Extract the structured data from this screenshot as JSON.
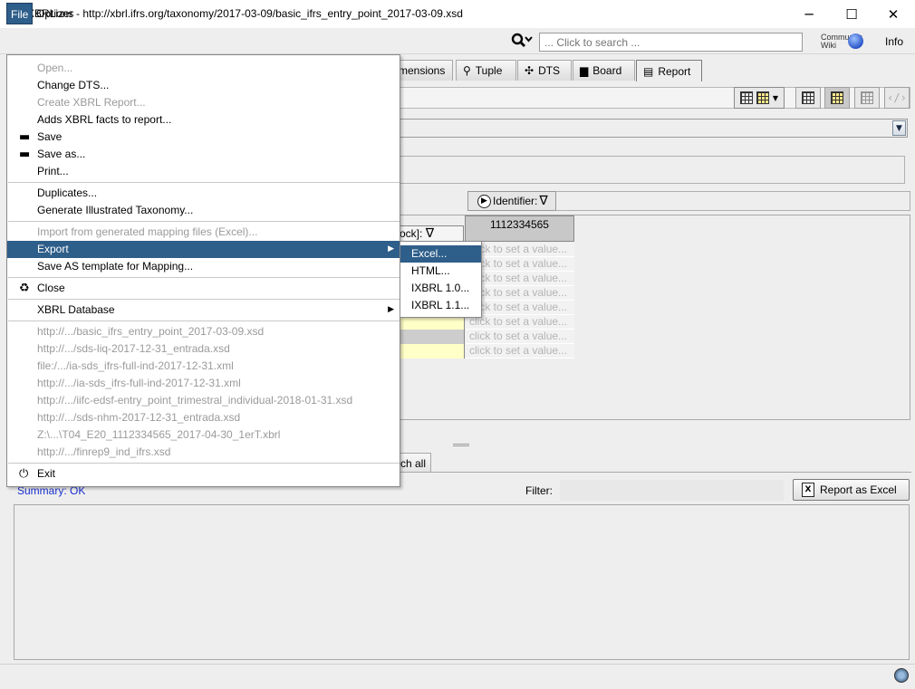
{
  "window": {
    "title": "XBRLizer - http://xbrl.ifrs.org/taxonomy/2017-03-09/basic_ifrs_entry_point_2017-03-09.xsd",
    "minimize": "─",
    "maximize": "☐",
    "close": "✕"
  },
  "menubar": {
    "file": "File",
    "options": "Options",
    "search_placeholder": "... Click to search ...",
    "community_wiki_line1": "Community",
    "community_wiki_line2": "Wiki",
    "info": "Info"
  },
  "tabs": [
    {
      "label": "mensions",
      "icon": ""
    },
    {
      "label": "Tuple",
      "icon": "paperclip-icon"
    },
    {
      "label": "DTS",
      "icon": "network-icon"
    },
    {
      "label": "Board",
      "icon": "board-icon"
    },
    {
      "label": "Report",
      "icon": "xbrl-report-icon",
      "active": true
    }
  ],
  "grid": {
    "block_header": "ock]:",
    "identifier_header": "Identifier:",
    "column_value": "1112334565",
    "placeholder": "click to set a value...",
    "row_colors": [
      "#eeeeee",
      "#eeeeee",
      "#eeeeee",
      "#eeeeee",
      "#eeeeee",
      "#ffffc8",
      "#cdcdcd",
      "#ffffc8"
    ]
  },
  "bottom": {
    "tab_label": "ch all",
    "summary": "Summary: OK",
    "filter_label": "Filter:",
    "filter_value": "",
    "report_button": "Report as Excel"
  },
  "file_menu": {
    "groups": [
      [
        {
          "label": "Open...",
          "disabled": true,
          "icon": ""
        },
        {
          "label": "Change DTS...",
          "disabled": false,
          "icon": ""
        },
        {
          "label": "Create XBRL Report...",
          "disabled": true,
          "icon": ""
        },
        {
          "label": "Adds XBRL facts to report...",
          "disabled": false,
          "icon": ""
        },
        {
          "label": "Save",
          "disabled": false,
          "icon": "save-icon"
        },
        {
          "label": "Save as...",
          "disabled": false,
          "icon": "save-as-icon"
        },
        {
          "label": "Print...",
          "disabled": false,
          "icon": ""
        }
      ],
      [
        {
          "label": "Duplicates...",
          "disabled": false,
          "icon": ""
        },
        {
          "label": "Generate Illustrated Taxonomy...",
          "disabled": false,
          "icon": ""
        }
      ],
      [
        {
          "label": "Import from generated mapping files (Excel)...",
          "disabled": true,
          "icon": ""
        },
        {
          "label": "Export",
          "disabled": false,
          "icon": "",
          "submenu": true,
          "selected": true
        },
        {
          "label": "Save AS template for Mapping...",
          "disabled": false,
          "icon": ""
        }
      ],
      [
        {
          "label": "Close",
          "disabled": false,
          "icon": "recycle-icon"
        }
      ],
      [
        {
          "label": "XBRL Database",
          "disabled": false,
          "icon": "",
          "submenu": true
        }
      ],
      [
        {
          "label": "http://.../basic_ifrs_entry_point_2017-03-09.xsd",
          "disabled": true,
          "icon": ""
        },
        {
          "label": "http://.../sds-liq-2017-12-31_entrada.xsd",
          "disabled": true,
          "icon": ""
        },
        {
          "label": "file:/.../ia-sds_ifrs-full-ind-2017-12-31.xml",
          "disabled": true,
          "icon": ""
        },
        {
          "label": "http://.../ia-sds_ifrs-full-ind-2017-12-31.xml",
          "disabled": true,
          "icon": ""
        },
        {
          "label": "http://.../iifc-edsf-entry_point_trimestral_individual-2018-01-31.xsd",
          "disabled": true,
          "icon": ""
        },
        {
          "label": "http://.../sds-nhm-2017-12-31_entrada.xsd",
          "disabled": true,
          "icon": ""
        },
        {
          "label": "Z:\\...\\T04_E20_1112334565_2017-04-30_1erT.xbrl",
          "disabled": true,
          "icon": ""
        },
        {
          "label": "http://.../finrep9_ind_ifrs.xsd",
          "disabled": true,
          "icon": ""
        }
      ],
      [
        {
          "label": "Exit",
          "disabled": false,
          "icon": "power-icon"
        }
      ]
    ]
  },
  "export_menu": {
    "items": [
      {
        "label": "Excel...",
        "selected": true
      },
      {
        "label": "HTML...",
        "selected": false
      },
      {
        "label": "IXBRL 1.0...",
        "selected": false
      },
      {
        "label": "IXBRL 1.1...",
        "selected": false
      }
    ]
  },
  "colors": {
    "selection": "#2e5e8a",
    "summary_text": "#1a30d0",
    "disabled_text": "#9a9a9a"
  }
}
